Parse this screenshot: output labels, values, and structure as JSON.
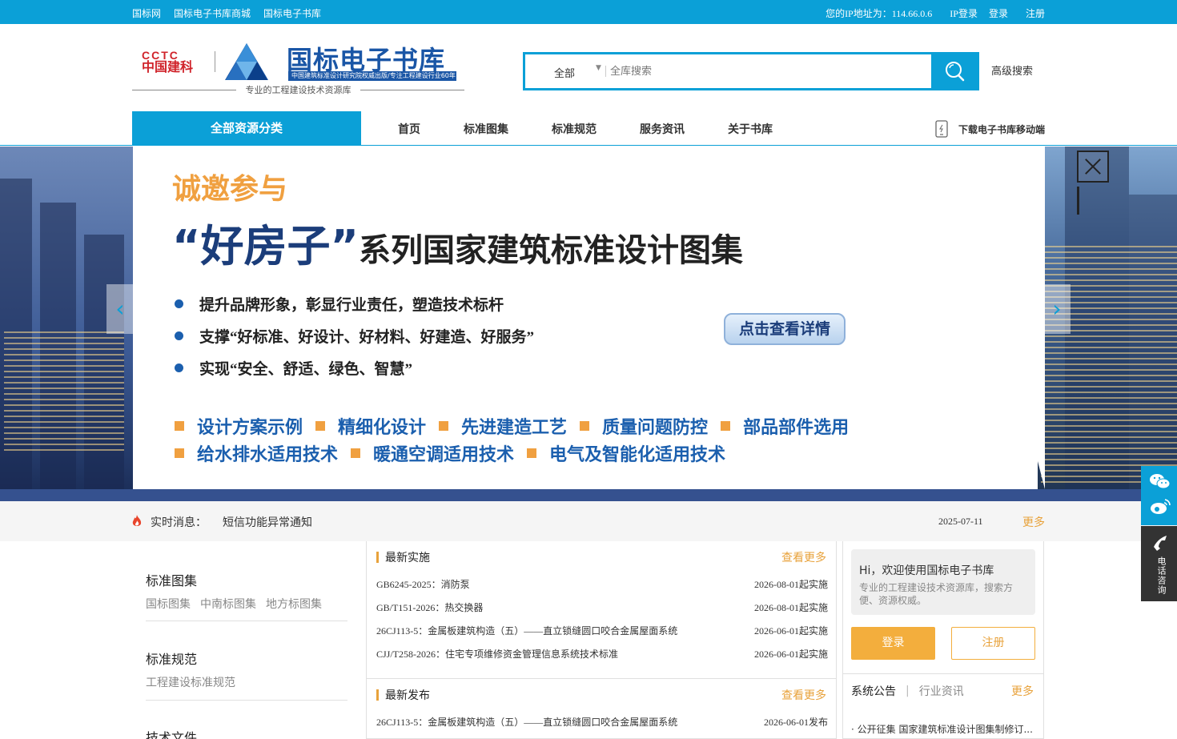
{
  "topbar": {
    "links": [
      "国标网",
      "国标电子书库商城",
      "国标电子书库"
    ],
    "ip_text": "您的IP地址为：114.66.0.6",
    "ip_login": "IP登录",
    "login": "登录",
    "register": "注册"
  },
  "logo": {
    "cctc_en": "CCTC",
    "cctc_cn": "中国建科",
    "brand": "国标电子书库",
    "brand_sub": "中国建筑标准设计研究院权威出版/专注工程建设行业60年",
    "slogan": "专业的工程建设技术资源库"
  },
  "search": {
    "category": "全部",
    "placeholder": "全库搜索",
    "advanced": "高级搜索"
  },
  "nav": {
    "all_categories": "全部资源分类",
    "links": [
      "首页",
      "标准图集",
      "标准规范",
      "服务资讯",
      "关于书库"
    ],
    "mobile": "下载电子书库移动端"
  },
  "banner": {
    "invite": "诚邀参与",
    "title_quote": "“好房子”",
    "title_rest": "系列国家建筑标准设计图集",
    "bullets": [
      "提升品牌形象，彰显行业责任，塑造技术标杆",
      "支撑“好标准、好设计、好材料、好建造、好服务”",
      "实现“安全、舒适、绿色、智慧”"
    ],
    "button": "点击查看详情",
    "tags_row1": [
      "设计方案示例",
      "精细化设计",
      "先进建造工艺",
      "质量问题防控",
      "部品部件选用"
    ],
    "tags_row2": [
      "给水排水适用技术",
      "暖通空调适用技术",
      "电气及智能化适用技术"
    ]
  },
  "ticker": {
    "label": "实时消息：",
    "message": "短信功能异常通知",
    "date": "2025-07-11",
    "more": "更多"
  },
  "categories": [
    {
      "title": "标准图集",
      "subs": [
        "国标图集",
        "中南标图集",
        "地方标图集"
      ]
    },
    {
      "title": "标准规范",
      "subs": [
        "工程建设标准规范"
      ]
    },
    {
      "title": "技术文件",
      "subs": []
    }
  ],
  "latest_impl": {
    "title": "最新实施",
    "more": "查看更多",
    "items": [
      {
        "name": "GB6245-2025：消防泵",
        "date": "2026-08-01起实施"
      },
      {
        "name": "GB/T151-2026：热交换器",
        "date": "2026-08-01起实施"
      },
      {
        "name": "26CJ113-5：金属板建筑构造（五）——直立锁缝圆口咬合金属屋面系统",
        "date": "2026-06-01起实施"
      },
      {
        "name": "CJJ/T258-2026：住宅专项维修资金管理信息系统技术标准",
        "date": "2026-06-01起实施"
      }
    ]
  },
  "latest_pub": {
    "title": "最新发布",
    "more": "查看更多",
    "items": [
      {
        "name": "26CJ113-5：金属板建筑构造（五）——直立锁缝圆口咬合金属屋面系统",
        "date": "2026-06-01发布"
      }
    ]
  },
  "user_panel": {
    "hi": "Hi，欢迎使用国标电子书库",
    "desc": "专业的工程建设技术资源库，搜索方便、资源权威。",
    "login": "登录",
    "register": "注册",
    "tab_notice": "系统公告",
    "tab_news": "行业资讯",
    "more": "更多",
    "news_item": "· 公开征集 国家建筑标准设计图集制修订..."
  },
  "side": {
    "phone": "电话咨询"
  },
  "colors": {
    "primary": "#0ba0d7",
    "accent": "#e8a23b",
    "banner_blue": "#1b3d7a",
    "band": "#35518f"
  }
}
